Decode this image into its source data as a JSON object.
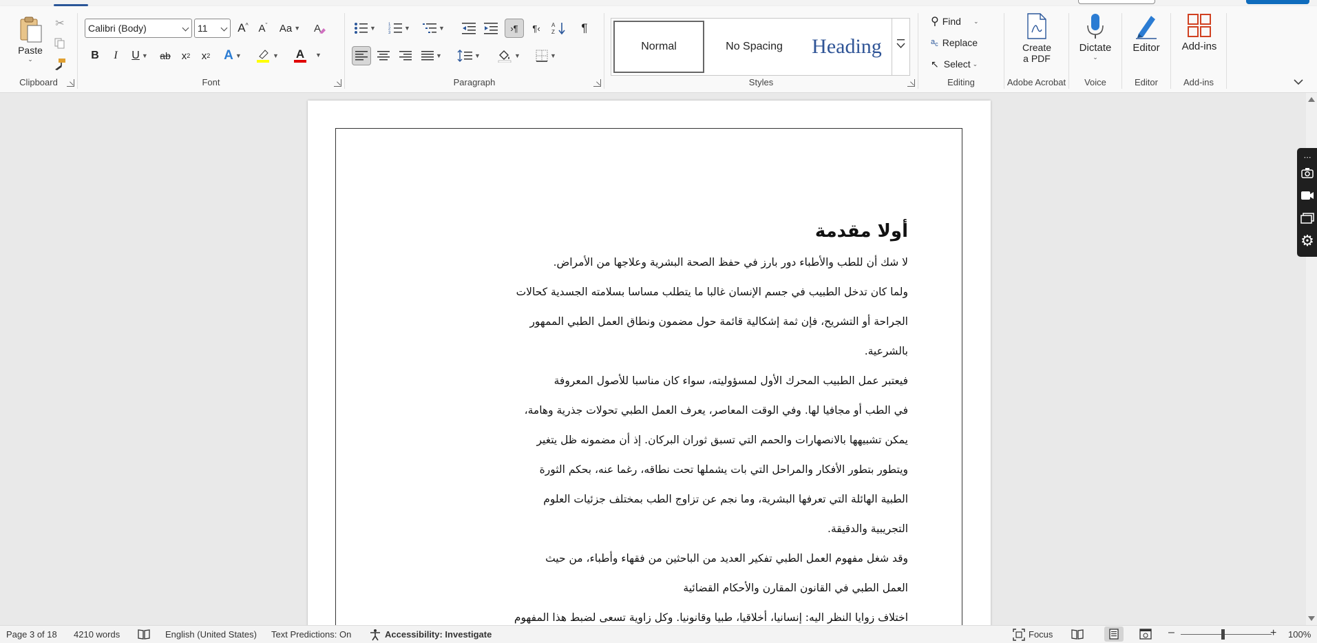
{
  "ribbon": {
    "clipboard": {
      "paste_label": "Paste",
      "group_label": "Clipboard"
    },
    "font": {
      "font_name": "Calibri (Body)",
      "font_size": "11",
      "change_case_label": "Aa",
      "bold": "B",
      "italic": "I",
      "underline": "U",
      "strikethrough": "ab",
      "subscript": "x",
      "subscript_sub": "2",
      "superscript": "x",
      "superscript_sup": "2",
      "text_effects": "A",
      "font_color_letter": "A",
      "highlight_color": "#ffff00",
      "font_color": "#e00000",
      "group_label": "Font"
    },
    "paragraph": {
      "group_label": "Paragraph"
    },
    "styles": {
      "items": [
        "Normal",
        "No Spacing",
        "Heading"
      ],
      "group_label": "Styles"
    },
    "editing": {
      "find": "Find",
      "replace": "Replace",
      "select": "Select",
      "group_label": "Editing"
    },
    "adobe": {
      "create_line1": "Create",
      "create_line2": "a PDF",
      "group_label": "Adobe Acrobat"
    },
    "voice": {
      "dictate": "Dictate",
      "group_label": "Voice"
    },
    "editor": {
      "label": "Editor",
      "group_label": "Editor"
    },
    "addins": {
      "label": "Add-ins",
      "group_label": "Add-ins"
    },
    "accent_color": "#2b579a"
  },
  "document": {
    "heading": "أولا مقدمة",
    "lines": [
      "لا شك أن للطب والأطباء دور بارز في حفظ الصحة البشرية وعلاجها من الأمراض.",
      "ولما كان تدخل الطبيب في جسم الإنسان غالبا ما يتطلب مساسا بسلامته الجسدية كحالات",
      "الجراحة أو التشريح، فإن ثمة إشكالية قائمة حول مضمون ونطاق العمل الطبي الممهور",
      "بالشرعية.",
      "فيعتبر عمل الطبيب المحرك الأول لمسؤوليته، سواء كان مناسبا للأصول المعروفة",
      "في الطب أو مجافيا لها. وفي الوقت المعاصر، يعرف العمل الطبي تحولات جذرية وهامة،",
      "يمكن تشبيهها بالانصهارات والحمم التي تسبق ثوران البركان. إذ أن مضمونه ظل يتغير",
      "ويتطور بتطور الأفكار والمراحل التي بات يشملها تحت نطاقه، رغما عنه، بحكم الثورة",
      "الطبية الهائلة التي تعرفها البشرية، وما نجم عن تزاوج الطب بمختلف جزئيات العلوم",
      "التجريبية والدقيقة.",
      "وقد شغل مفهوم العمل الطبي تفكير العديد من الباحثين من فقهاء وأطباء، من حيث",
      "العمل الطبي في القانون المقارن والأحكام القضائية",
      "اختلاف زوايا النظر اليه: إنسانيا، أخلاقيا، طبيا وقانونيا. وكل زاوية تسعى لضبط هذا المفهوم"
    ]
  },
  "statusbar": {
    "page": "Page 3 of 18",
    "words": "4210 words",
    "language": "English (United States)",
    "text_predictions": "Text Predictions: On",
    "accessibility": "Accessibility: Investigate",
    "focus": "Focus",
    "zoom": "100%"
  }
}
